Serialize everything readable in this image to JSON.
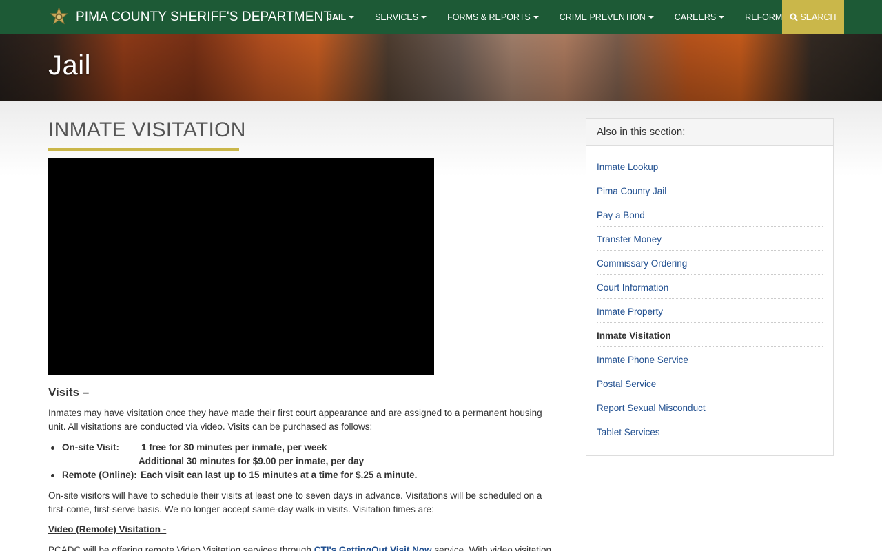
{
  "header": {
    "brand": "PIMA COUNTY SHERIFF'S DEPARTMENT",
    "nav": [
      {
        "label": "JAIL",
        "active": true
      },
      {
        "label": "SERVICES"
      },
      {
        "label": "FORMS & REPORTS"
      },
      {
        "label": "CRIME PREVENTION"
      },
      {
        "label": "CAREERS"
      },
      {
        "label": "REFORM"
      }
    ],
    "search_label": "SEARCH",
    "colors": {
      "nav_bg": "#1d5a36",
      "accent": "#cab74a"
    }
  },
  "hero": {
    "title": "Jail"
  },
  "main": {
    "title": "INMATE VISITATION",
    "visits_heading": "Visits –",
    "intro": "Inmates may have visitation once they have made their first court appearance and are assigned to a permanent housing unit. All visitations are conducted via video.  Visits can be purchased as follows:",
    "list": {
      "onsite_label": "On-site Visit:",
      "onsite_detail_1": "1 free for 30 minutes per inmate, per week",
      "onsite_detail_2": "Additional 30 minutes for $9.00 per inmate, per day",
      "remote_label": "Remote (Online):",
      "remote_detail": "Each visit can last up to 15 minutes at a time for $.25 a minute."
    },
    "schedule_text": "On-site visitors will have to schedule their visits at least one to seven days in advance. Visitations will be scheduled on a first-come, first-serve basis. We no longer accept same-day walk-in visits. Visitation times are:",
    "video_heading": "Video (Remote) Visitation -",
    "video_text_before": "PCADC will be offering remote Video Visitation services through ",
    "video_link": "CTI's GettingOut Visit Now",
    "video_text_after": " service. With video visitation"
  },
  "sidebar": {
    "heading": "Also in this section:",
    "items": [
      {
        "label": "Inmate Lookup"
      },
      {
        "label": "Pima County Jail"
      },
      {
        "label": "Pay a Bond"
      },
      {
        "label": "Transfer Money"
      },
      {
        "label": "Commissary Ordering"
      },
      {
        "label": "Court Information"
      },
      {
        "label": "Inmate Property"
      },
      {
        "label": "Inmate Visitation",
        "current": true
      },
      {
        "label": "Inmate Phone Service"
      },
      {
        "label": "Postal Service"
      },
      {
        "label": "Report Sexual Misconduct"
      },
      {
        "label": "Tablet Services"
      }
    ]
  }
}
